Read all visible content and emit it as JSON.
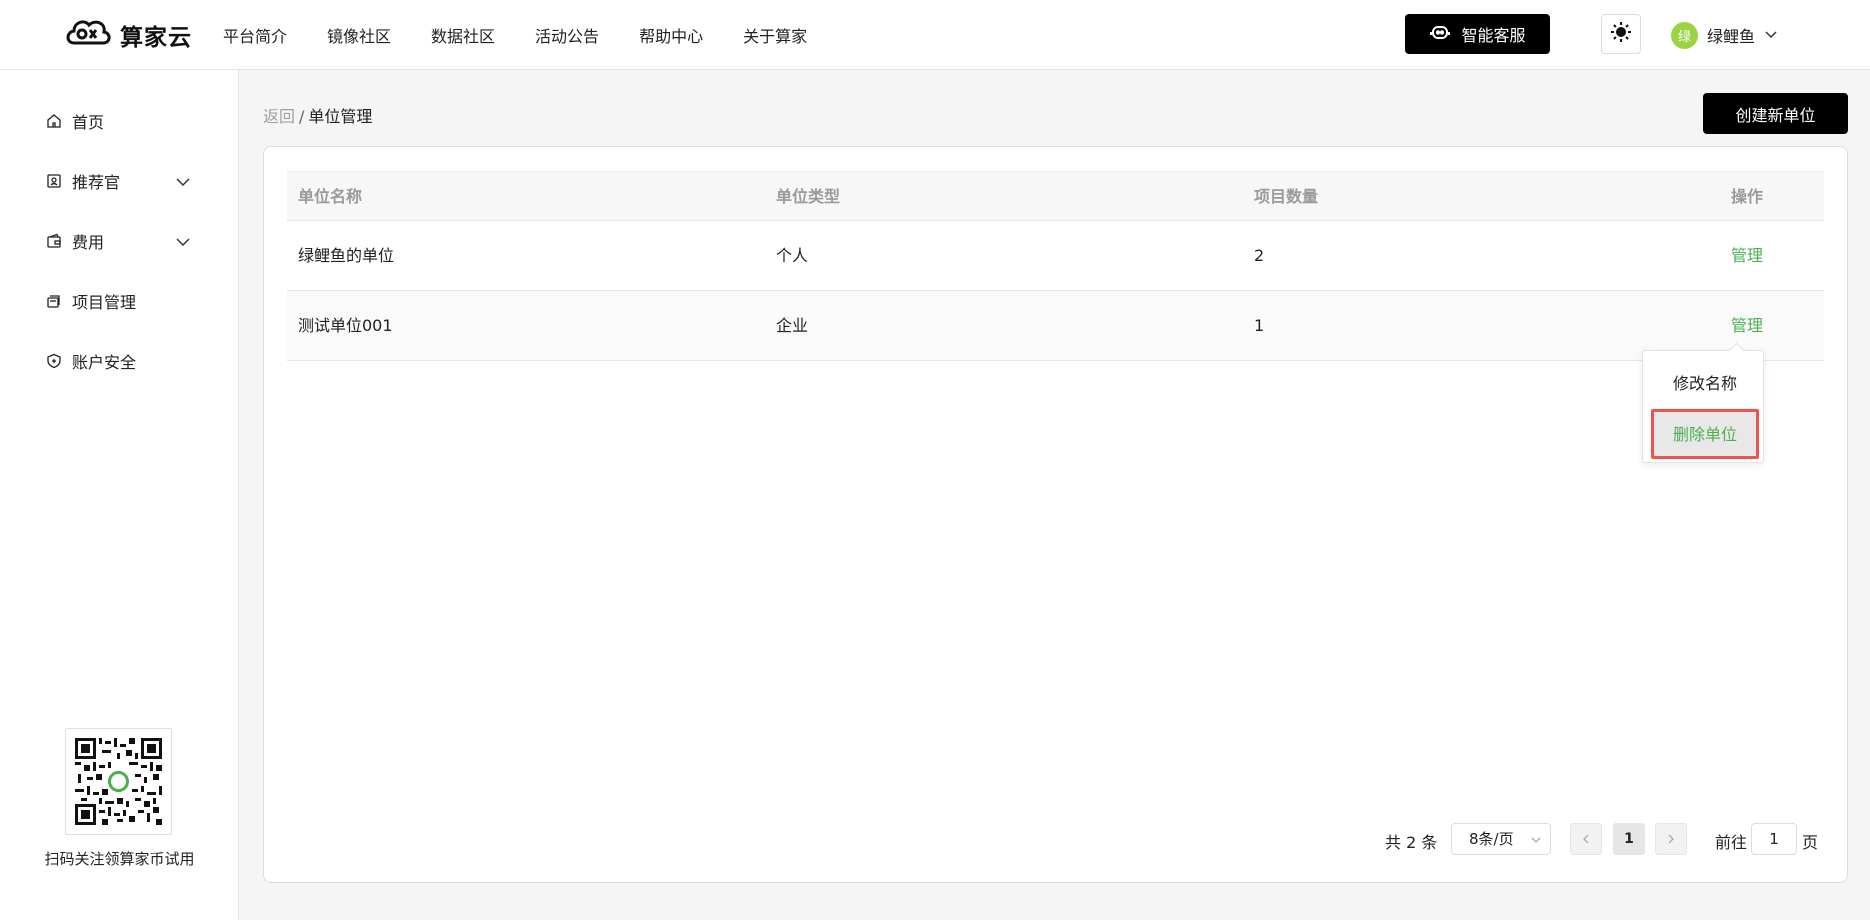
{
  "header": {
    "logo_text": "算家云",
    "nav": [
      "平台简介",
      "镜像社区",
      "数据社区",
      "活动公告",
      "帮助中心",
      "关于算家"
    ],
    "service_label": "智能客服",
    "user_avatar": "绿",
    "user_name": "绿鲤鱼"
  },
  "sidebar": {
    "items": [
      {
        "label": "首页",
        "icon": "home-icon"
      },
      {
        "label": "推荐官",
        "icon": "badge-icon"
      },
      {
        "label": "费用",
        "icon": "wallet-icon"
      },
      {
        "label": "项目管理",
        "icon": "stack-icon"
      },
      {
        "label": "账户安全",
        "icon": "shield-icon"
      }
    ],
    "qr_caption": "扫码关注领算家币试用"
  },
  "breadcrumb": {
    "back": "返回",
    "separator": "/",
    "current": "单位管理"
  },
  "create_button": "创建新单位",
  "table": {
    "headers": [
      "单位名称",
      "单位类型",
      "项目数量",
      "操作"
    ],
    "rows": [
      {
        "name": "绿鲤鱼的单位",
        "type": "个人",
        "count": "2",
        "action": "管理"
      },
      {
        "name": "测试单位001",
        "type": "企业",
        "count": "1",
        "action": "管理"
      }
    ]
  },
  "dropdown": {
    "rename": "修改名称",
    "delete": "删除单位"
  },
  "pagination": {
    "total": "共 2 条",
    "page_size": "8条/页",
    "current_page": "1",
    "goto_label": "前往",
    "goto_value": "1",
    "page_suffix": "页"
  },
  "colors": {
    "accent_green": "#4caf50",
    "avatar_green": "#9bd343",
    "highlight_red": "#ef5350",
    "button_black": "#000000"
  }
}
